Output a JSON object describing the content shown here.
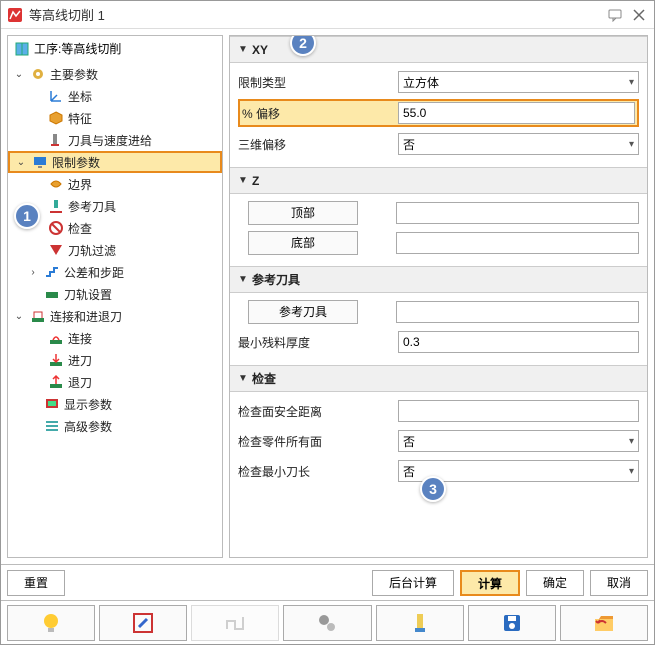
{
  "window": {
    "title": "等高线切削 1"
  },
  "tree": {
    "header": "工序:等高线切削",
    "n_mainparams": "主要参数",
    "n_coord": "坐标",
    "n_feature": "特征",
    "n_toolspeed": "刀具与速度进给",
    "n_limitparams": "限制参数",
    "n_boundary": "边界",
    "n_reftool": "参考刀具",
    "n_check": "检查",
    "n_pathfilter": "刀轨过滤",
    "n_tolstep": "公差和步距",
    "n_pathset": "刀轨设置",
    "n_linklead": "连接和进退刀",
    "n_link": "连接",
    "n_leadin": "进刀",
    "n_leadout": "退刀",
    "n_display": "显示参数",
    "n_advanced": "高级参数"
  },
  "sections": {
    "xy": {
      "title": "XY",
      "limit_type_label": "限制类型",
      "limit_type_value": "立方体",
      "pct_offset_label": "% 偏移",
      "pct_offset_value": "55.0",
      "offset3d_label": "三维偏移",
      "offset3d_value": "否"
    },
    "z": {
      "title": "Z",
      "top_btn": "顶部",
      "bottom_btn": "底部"
    },
    "reftool": {
      "title": "参考刀具",
      "reftool_btn": "参考刀具",
      "min_rest_label": "最小残料厚度",
      "min_rest_value": "0.3"
    },
    "check": {
      "title": "检查",
      "safe_dist_label": "检查面安全距离",
      "safe_dist_value": "",
      "allfaces_label": "检查零件所有面",
      "allfaces_value": "否",
      "mintool_label": "检查最小刀长",
      "mintool_value": "否"
    }
  },
  "buttons": {
    "reset": "重置",
    "bgcalc": "后台计算",
    "calc": "计算",
    "ok": "确定",
    "cancel": "取消"
  },
  "callouts": {
    "c1": "1",
    "c2": "2",
    "c3": "3"
  }
}
